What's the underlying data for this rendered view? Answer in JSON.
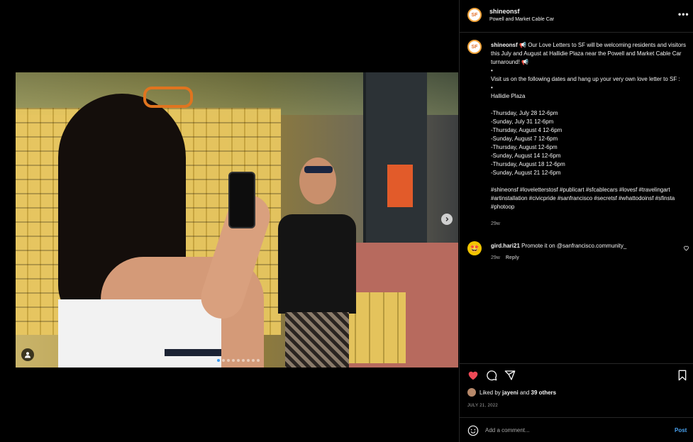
{
  "header": {
    "username": "shineonsf",
    "location": "Powell and Market Cable Car",
    "avatar_text": "SF"
  },
  "caption": {
    "username": "shineonsf",
    "text": " 📢 Our Love Letters to SF will be welcoming residents and visitors this July and August at Hallidie Plaza near the Powell and Market Cable Car turnaround! 📢\n•\nVisit us on the following dates and hang up your very own love letter to SF :\n•\nHallidie Plaza\n\n-Thursday, July 28 12-6pm\n-Sunday, July 31 12-6pm\n-Thursday, August 4 12-6pm\n-Sunday, August 7 12-6pm\n-Thursday, August 12-6pm\n-Sunday, August 14 12-6pm\n-Thursday, August 18 12-6pm\n-Sunday, August 21 12-6pm\n\n#shineonsf #loveletterstosf #publicart #sfcablecars #lovesf #travelingart #artinstallation #civicpride #sanfrancisco #secretsf #whattodoinsf #sfinsta #photoop",
    "time": "29w"
  },
  "comment": {
    "username": "gird.hari21",
    "text": " Promote it on @sanfrancisco.community_",
    "time": "29w",
    "reply_label": "Reply",
    "avatar_emoji": "🤩"
  },
  "likes": {
    "prefix": "Liked by ",
    "user": "jayeni",
    "middle": " and ",
    "others": "39 others"
  },
  "date": "JULY 21, 2022",
  "composer": {
    "placeholder": "Add a comment...",
    "post_label": "Post"
  },
  "more_label": "•••",
  "colors": {
    "like_red": "#ed4956",
    "post_blue": "#4aa3f0",
    "border": "#262626"
  }
}
